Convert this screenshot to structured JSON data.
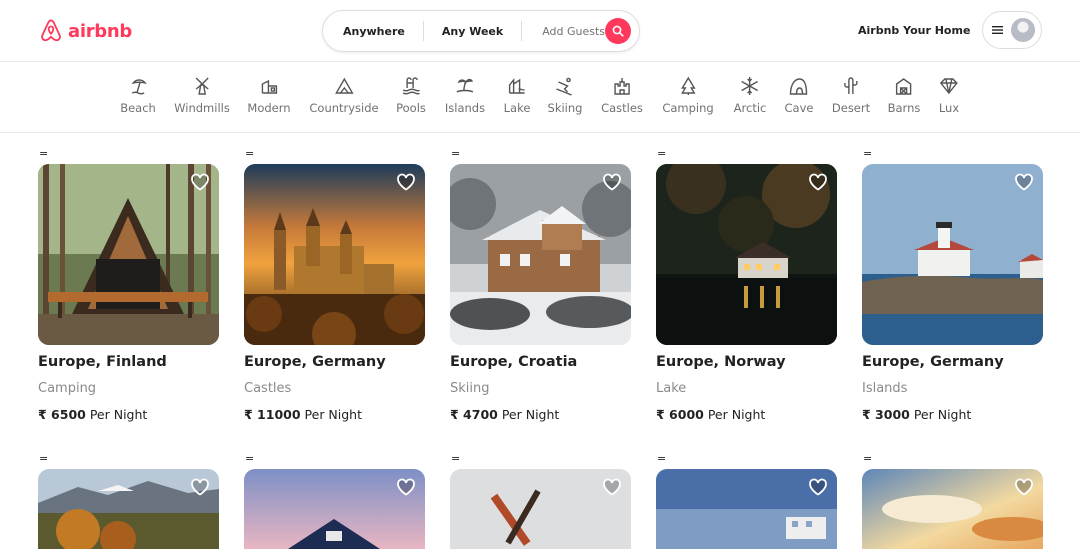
{
  "brand": {
    "name": "airbnb",
    "color": "#ff385c"
  },
  "search": {
    "anywhere": "Anywhere",
    "any_week": "Any Week",
    "guests": "Add Guests"
  },
  "header": {
    "host_link": "Airbnb Your Home"
  },
  "categories": [
    {
      "label": "Beach",
      "icon": "beach-icon"
    },
    {
      "label": "Windmills",
      "icon": "windmill-icon"
    },
    {
      "label": "Modern",
      "icon": "modern-house-icon"
    },
    {
      "label": "Countryside",
      "icon": "countryside-icon"
    },
    {
      "label": "Pools",
      "icon": "pool-icon"
    },
    {
      "label": "Islands",
      "icon": "island-icon"
    },
    {
      "label": "Lake",
      "icon": "lake-icon"
    },
    {
      "label": "Skiing",
      "icon": "skiing-icon"
    },
    {
      "label": "Castles",
      "icon": "castle-icon"
    },
    {
      "label": "Camping",
      "icon": "camping-icon"
    },
    {
      "label": "Arctic",
      "icon": "snowflake-icon"
    },
    {
      "label": "Cave",
      "icon": "cave-icon"
    },
    {
      "label": "Desert",
      "icon": "cactus-icon"
    },
    {
      "label": "Barns",
      "icon": "barn-icon"
    },
    {
      "label": "Lux",
      "icon": "diamond-icon"
    }
  ],
  "listings": [
    {
      "location": "Europe, Finland",
      "category": "Camping",
      "price": "₹ 6500",
      "per": "Per Night",
      "marker": "="
    },
    {
      "location": "Europe, Germany",
      "category": "Castles",
      "price": "₹ 11000",
      "per": "Per Night",
      "marker": "="
    },
    {
      "location": "Europe, Croatia",
      "category": "Skiing",
      "price": "₹ 4700",
      "per": "Per Night",
      "marker": "="
    },
    {
      "location": "Europe, Norway",
      "category": "Lake",
      "price": "₹ 6000",
      "per": "Per Night",
      "marker": "="
    },
    {
      "location": "Europe, Germany",
      "category": "Islands",
      "price": "₹ 3000",
      "per": "Per Night",
      "marker": "="
    }
  ],
  "listings_row2_markers": [
    "=",
    "=",
    "=",
    "=",
    "="
  ]
}
